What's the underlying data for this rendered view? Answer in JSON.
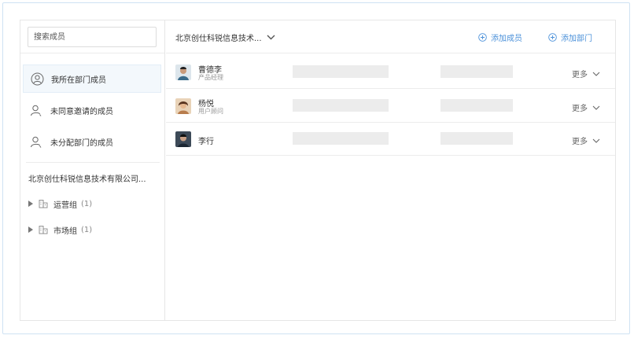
{
  "sidebar": {
    "search": {
      "placeholder": "搜索成员",
      "value": ""
    },
    "nav": [
      {
        "label": "我所在部门成员",
        "icon": "user-circle-icon",
        "active": true
      },
      {
        "label": "未同意邀请的成员",
        "icon": "user-pending-icon",
        "active": false
      },
      {
        "label": "未分配部门的成员",
        "icon": "user-unassigned-icon",
        "active": false
      }
    ],
    "company": "北京创仕科锐信息技术有限公司...",
    "groups": [
      {
        "name": "运营组",
        "count": "(1)",
        "icon": "building-icon"
      },
      {
        "name": "市场组",
        "count": "(1)",
        "icon": "building-icon"
      }
    ]
  },
  "main": {
    "dept_select": "北京创仕科锐信息技术...",
    "actions": {
      "add_member": "添加成员",
      "add_department": "添加部门"
    },
    "members": [
      {
        "name": "曹德李",
        "role": "产品经理",
        "more": "更多",
        "avatar_color": "#3a6b8a"
      },
      {
        "name": "杨悦",
        "role": "用户顾问",
        "more": "更多",
        "avatar_color": "#b87c4c"
      },
      {
        "name": "李行",
        "role": "",
        "more": "更多",
        "avatar_color": "#2b3b4d"
      }
    ]
  },
  "colors": {
    "accent": "#4a90d9",
    "active_bg": "#f3f8fc",
    "placeholder_bar": "#ececec"
  }
}
